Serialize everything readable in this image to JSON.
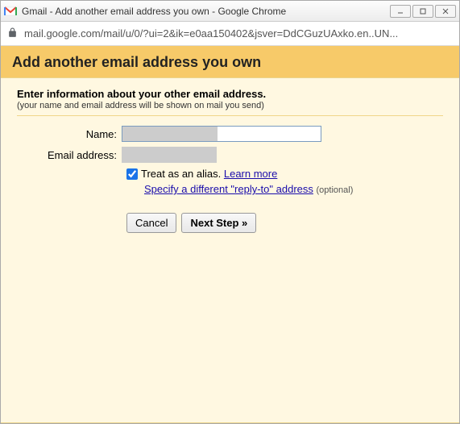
{
  "window": {
    "title": "Gmail - Add another email address you own - Google Chrome"
  },
  "address": {
    "url": "mail.google.com/mail/u/0/?ui=2&ik=e0aa150402&jsver=DdCGuzUAxko.en..UN..."
  },
  "page": {
    "heading": "Add another email address you own",
    "intro_lead": "Enter information about your other email address.",
    "intro_sub": "(your name and email address will be shown on mail you send)"
  },
  "form": {
    "name_label": "Name:",
    "name_value": "",
    "email_label": "Email address:",
    "email_value": "",
    "alias_checked": true,
    "alias_label": "Treat as an alias.",
    "learn_more": "Learn more",
    "reply_to_link": "Specify a different \"reply-to\" address",
    "reply_to_optional": "(optional)",
    "cancel": "Cancel",
    "next": "Next Step »"
  }
}
